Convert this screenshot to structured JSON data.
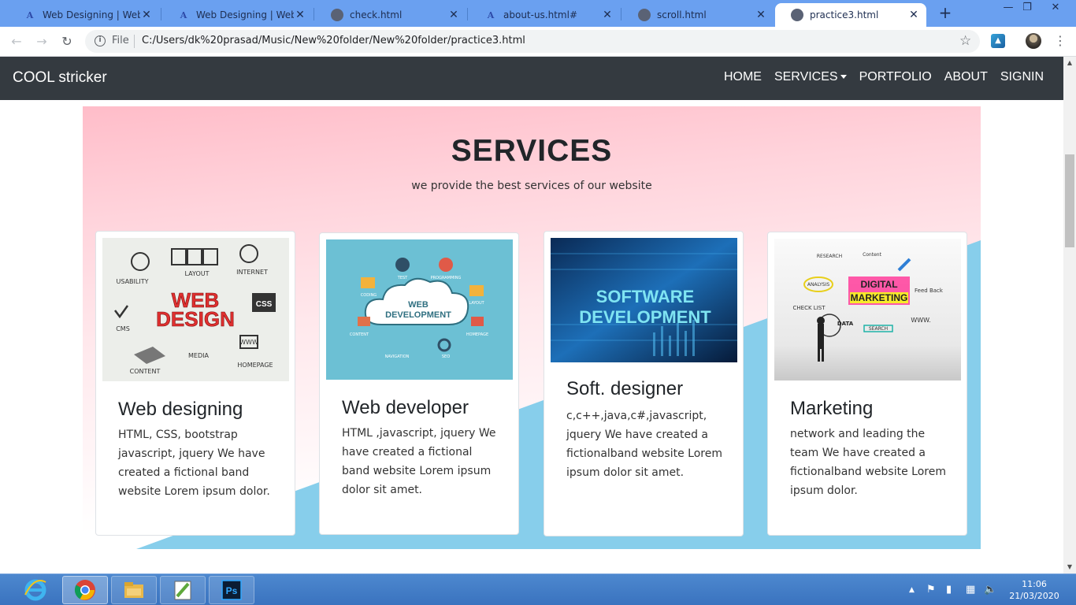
{
  "browser": {
    "tabs": [
      {
        "title": "Web Designing | Website",
        "favicon": "at-logo-icon",
        "active": false
      },
      {
        "title": "Web Designing | Website",
        "favicon": "at-logo-icon",
        "active": false
      },
      {
        "title": "check.html",
        "favicon": "globe-icon",
        "active": false
      },
      {
        "title": "about-us.html#",
        "favicon": "at-logo-icon",
        "active": false
      },
      {
        "title": "scroll.html",
        "favicon": "globe-icon",
        "active": false
      },
      {
        "title": "practice3.html",
        "favicon": "globe-icon",
        "active": true
      }
    ],
    "new_tab_label": "+",
    "address": {
      "scheme_label": "File",
      "url": "C:/Users/dk%20prasad/Music/New%20folder/New%20folder/practice3.html"
    }
  },
  "site": {
    "brand": "COOL stricker",
    "nav": [
      "HOME",
      "SERVICES",
      "PORTFOLIO",
      "ABOUT",
      "SIGNIN"
    ]
  },
  "services": {
    "title": "SERVICES",
    "subtitle": "we provide the best services of our website",
    "cards": [
      {
        "title": "Web designing",
        "text": "HTML, CSS, bootstrap javascript, jquery We have created a fictional band website Lorem ipsum dolor.",
        "image": {
          "headline": [
            "WEB",
            "DESIGN"
          ],
          "labels": [
            "USABILITY",
            "LAYOUT",
            "INTERNET",
            "CSS",
            "CMS",
            "MEDIA",
            "WWW",
            "CONTENT",
            "HOMEPAGE"
          ]
        }
      },
      {
        "title": "Web developer",
        "text": "HTML ,javascript, jquery We have created a fictional band website Lorem ipsum dolor sit amet.",
        "image": {
          "headline": [
            "WEB",
            "DEVELOPMENT"
          ],
          "labels": [
            "TEST",
            "PROGRAMMING",
            "CODING",
            "LAYOUT",
            "CONTENT",
            "HOMEPAGE",
            "NAVIGATION",
            "SEO"
          ]
        }
      },
      {
        "title": "Soft. designer",
        "text": "c,c++,java,c#,javascript, jquery We have created a fictionalband website Lorem ipsum dolor sit amet.",
        "image": {
          "headline": [
            "SOFTWARE",
            "DEVELOPMENT"
          ]
        }
      },
      {
        "title": "Marketing",
        "text": "network and leading the team We have created a fictionalband website Lorem ipsum dolor.",
        "image": {
          "headline": [
            "DIGITAL",
            "MARKETING"
          ],
          "labels": [
            "RESEARCH",
            "Content",
            "ANALYSIS",
            "Feed Back",
            "CHECK LIST",
            "DATA",
            "SEARCH",
            "WWW."
          ]
        }
      }
    ]
  },
  "taskbar": {
    "apps": [
      "internet-explorer",
      "chrome",
      "file-explorer",
      "notepad-plus-plus",
      "photoshop"
    ],
    "clock_time": "11:06",
    "clock_date": "21/03/2020"
  },
  "colors": {
    "nav_bg": "#343a40",
    "tab_strip": "#6aa0f0",
    "section_top": "#ffbdc9",
    "wave": "#87ceeb",
    "taskbar": "#3a73bf"
  }
}
